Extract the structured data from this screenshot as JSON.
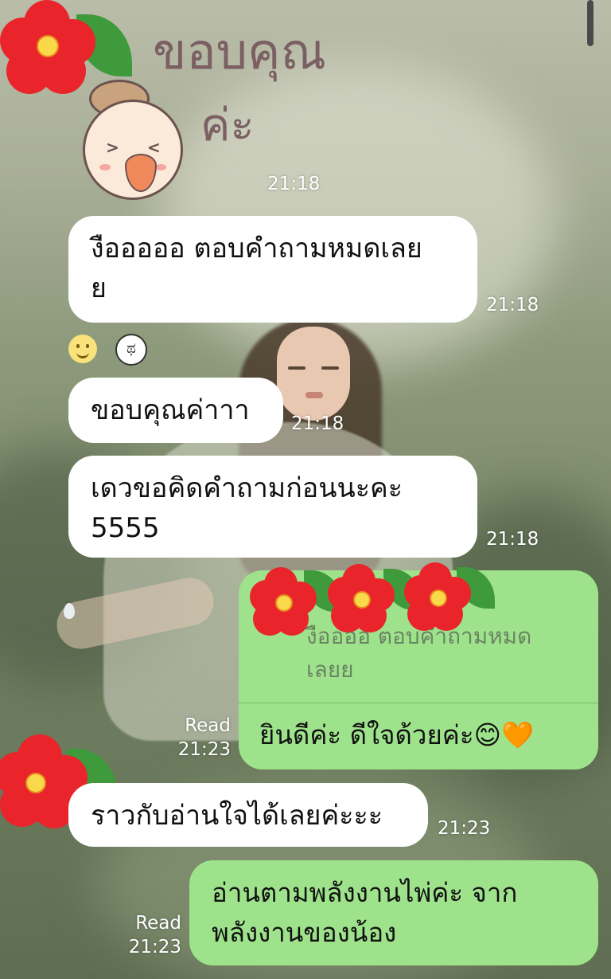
{
  "chat": {
    "sticker": {
      "text_line1": "ขอบคุณ",
      "text_line2": "ค่ะ",
      "time": "21:18"
    },
    "messages": [
      {
        "text_line1": "งือออออ ตอบคำถามหมดเลย",
        "text_line2": "ย",
        "time": "21:18"
      },
      {
        "text": "ขอบคุณค่าาา",
        "time": "21:18"
      },
      {
        "text_line1": "เดวขอคิดคำถามก่อนนะคะ",
        "text_line2": "5555",
        "time": "21:18"
      },
      {
        "quoted_line1": "งืออออ ตอบคำถามหมด",
        "quoted_line2": "เลยย",
        "text": "ยินดีค่ะ ดีใจด้วยค่ะ😊🧡",
        "status": "Read",
        "time": "21:23"
      },
      {
        "text": "ราวกับอ่านใจได้เลยค่ะะะ",
        "time": "21:23"
      },
      {
        "text_line1": "อ่านตามพลังงานไพ่ค่ะ จาก",
        "text_line2": "พลังงานของน้อง",
        "status": "Read",
        "time": "21:23"
      }
    ],
    "reactions": [
      "smile-reaction-icon",
      "crying-reaction-icon"
    ]
  },
  "colors": {
    "incoming_bubble": "#ffffff",
    "outgoing_bubble": "#9ee38c",
    "flower": "#e9242b",
    "flower_center": "#f9d94a",
    "leaf": "#3f9a3c"
  }
}
